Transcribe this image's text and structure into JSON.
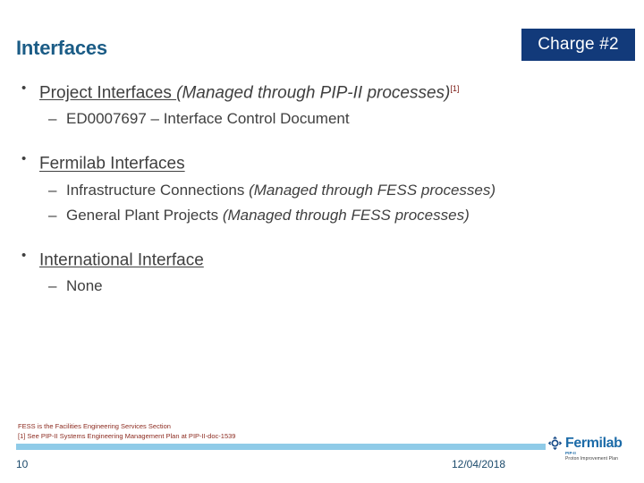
{
  "slide": {
    "title": "Interfaces",
    "badge_label": "Charge #2",
    "badge_color": "#123A7A",
    "title_color": "#1B5C86"
  },
  "content": {
    "groups": [
      {
        "bullet_glyph": "•",
        "heading": "Project Interfaces ",
        "note": "(Managed through PIP-II processes)",
        "ref": "[1]",
        "subitems": [
          {
            "dash": "–",
            "text": "ED0007697 – Interface Control Document",
            "note": ""
          }
        ]
      },
      {
        "bullet_glyph": "•",
        "heading": "Fermilab Interfaces ",
        "note": "",
        "ref": "",
        "subitems": [
          {
            "dash": "–",
            "text": "Infrastructure Connections ",
            "note": "(Managed through FESS processes)"
          },
          {
            "dash": "–",
            "text": "General Plant Projects ",
            "note": "(Managed through FESS processes)"
          }
        ]
      },
      {
        "bullet_glyph": "•",
        "heading": "International Interface",
        "note": "",
        "ref": "",
        "subitems": [
          {
            "dash": "–",
            "text": "None",
            "note": ""
          }
        ]
      }
    ]
  },
  "footnotes": {
    "line1": "FESS is the Facilities Engineering Services Section",
    "line2": "[1] See PIP-II Systems Engineering Management Plan at PIP-II-doc-1539",
    "color": "#8C2B20"
  },
  "footer": {
    "page_number": "10",
    "date": "12/04/2018",
    "rule_color": "#8FCBE8"
  },
  "logo": {
    "wordmark": "Fermilab",
    "sub_line1": "PIP-II",
    "sub_line2": "Proton Improvement Plan",
    "mark_color": "#1C4E8A",
    "word_color": "#1C6BA8"
  }
}
